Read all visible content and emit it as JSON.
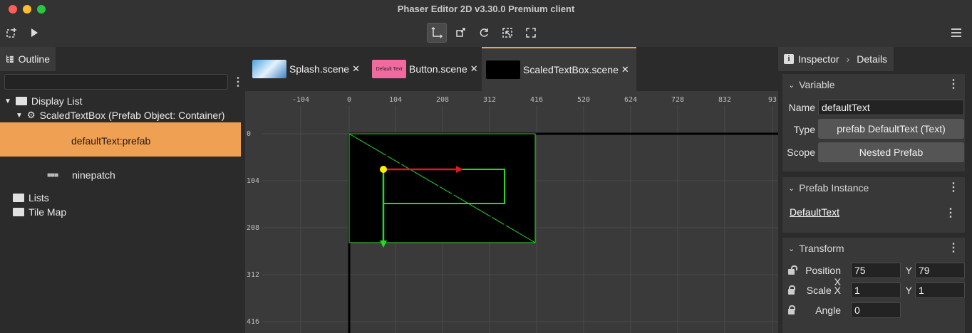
{
  "window": {
    "title": "Phaser Editor 2D v3.30.0 Premium client",
    "light_colors": [
      "#ff5f57",
      "#febc2e",
      "#28c840"
    ]
  },
  "toolbar": {
    "tools": [
      "translate-tool",
      "scale-tool",
      "rotate-tool",
      "select-region-tool",
      "fullscreen-tool"
    ],
    "active_tool": "translate-tool"
  },
  "outline": {
    "tab_label": "Outline",
    "filter_value": "",
    "tree": {
      "display_list": "Display List",
      "container": "ScaledTextBox (Prefab Object: Container)",
      "selected_item": "defaultText:prefab",
      "ninepatch": "ninepatch",
      "lists": "Lists",
      "tile_map": "Tile Map"
    },
    "selection_color": "#f0a052"
  },
  "editor": {
    "tabs": [
      {
        "label": "Splash.scene"
      },
      {
        "label": "Button.scene",
        "thumb_text": "Default Text"
      },
      {
        "label": "ScaledTextBox.scene"
      }
    ],
    "active_tab": "ScaledTextBox.scene",
    "ruler_x": [
      "-104",
      "0",
      "104",
      "208",
      "312",
      "416",
      "520",
      "624",
      "728",
      "832",
      "93"
    ],
    "ruler_y": [
      "0",
      "104",
      "208",
      "312",
      "416"
    ]
  },
  "inspector": {
    "tab_label": "Inspector",
    "breadcrumb": "Details",
    "variable": {
      "title": "Variable",
      "name_label": "Name",
      "name_value": "defaultText",
      "type_label": "Type",
      "type_value": "prefab DefaultText (Text)",
      "scope_label": "Scope",
      "scope_value": "Nested Prefab"
    },
    "prefab_instance": {
      "title": "Prefab Instance",
      "link": "DefaultText"
    },
    "transform": {
      "title": "Transform",
      "position_label": "Position",
      "scale_label": "Scale",
      "angle_label": "Angle",
      "x_label": "X",
      "y_label": "Y",
      "position_x": "75",
      "position_y": "79",
      "scale_x": "1",
      "scale_y": "1",
      "angle": "0"
    }
  }
}
